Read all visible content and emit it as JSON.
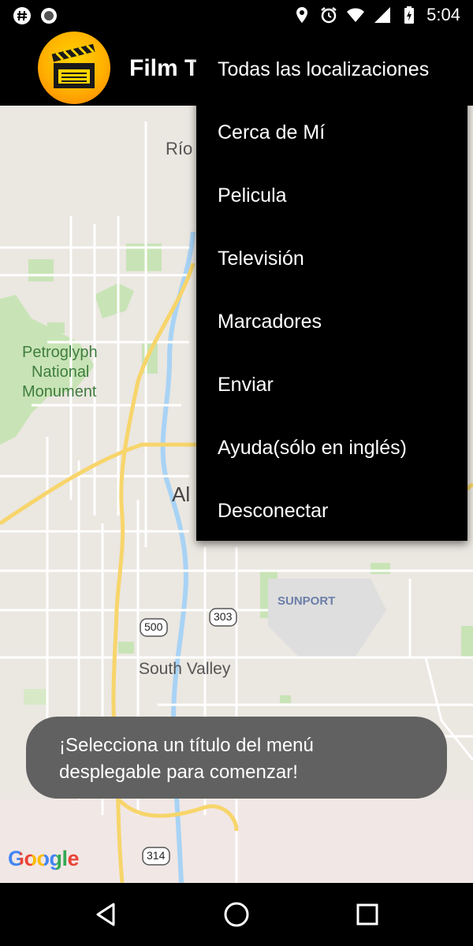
{
  "status_bar": {
    "time": "5:04",
    "icons": [
      "hash-icon",
      "record-icon",
      "location-icon",
      "alarm-icon",
      "wifi-icon",
      "signal-icon",
      "battery-charging-icon"
    ]
  },
  "app_bar": {
    "title": "Film T",
    "logo_icon": "clapperboard-icon",
    "overflow_icon": "more-vert-icon"
  },
  "menu": {
    "items": [
      {
        "label": "Todas las localizaciones"
      },
      {
        "label": "Cerca de Mí"
      },
      {
        "label": "Pelicula"
      },
      {
        "label": "Televisión"
      },
      {
        "label": "Marcadores"
      },
      {
        "label": "Enviar"
      },
      {
        "label": "Ayuda(sólo en inglés)"
      },
      {
        "label": "Desconectar"
      }
    ]
  },
  "map": {
    "labels": {
      "rio": "Río",
      "petroglyph_1": "Petroglyph",
      "petroglyph_2": "National",
      "petroglyph_3": "Monument",
      "city": "Al",
      "sunport": "SUNPORT",
      "south_valley": "South Valley",
      "route_500": "500",
      "route_303": "303",
      "route_314": "314"
    },
    "google_logo": "Google"
  },
  "toast": {
    "message": "¡Selecciona un título del menú desplegable para comenzar!"
  },
  "nav_bar": {
    "back_icon": "back-triangle-icon",
    "home_icon": "home-circle-icon",
    "recents_icon": "recents-square-icon"
  },
  "colors": {
    "map_background": "#ebe7e1",
    "park_green": "#b6dca2",
    "highway_yellow": "#f7d56b",
    "river_blue": "#a8d3f5",
    "menu_background": "#000000",
    "toast_background": "#616161"
  }
}
